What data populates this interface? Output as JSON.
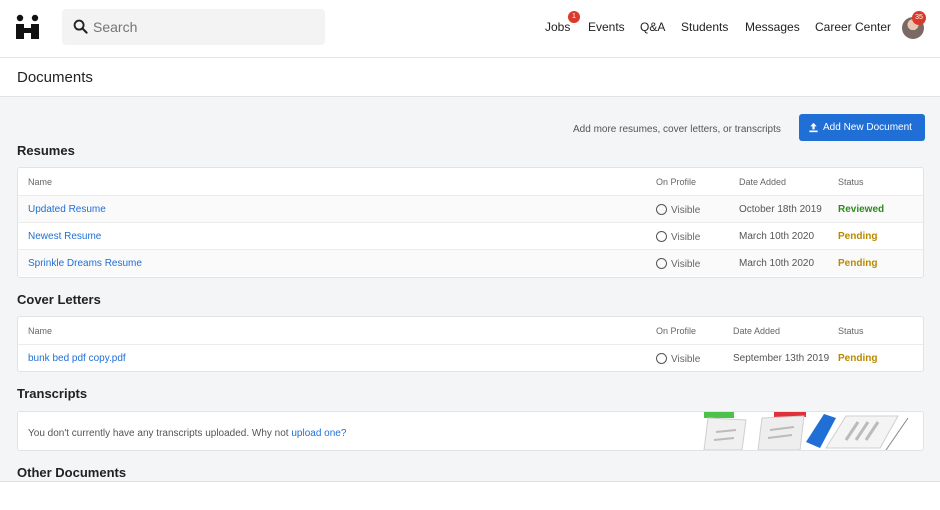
{
  "search": {
    "placeholder": "Search"
  },
  "nav": {
    "items": [
      {
        "label": "Jobs"
      },
      {
        "label": "Events"
      },
      {
        "label": "Q&A"
      },
      {
        "label": "Students"
      },
      {
        "label": "Messages"
      },
      {
        "label": "Career Center"
      }
    ],
    "jobs_badge": "1",
    "avatar_badge": "35"
  },
  "page": {
    "title": "Documents"
  },
  "toolbar": {
    "hint": "Add more resumes, cover letters, or transcripts",
    "add_label": "Add New Document"
  },
  "resumes": {
    "title": "Resumes",
    "headers": {
      "name": "Name",
      "on_profile": "On Profile",
      "date_added": "Date Added",
      "status": "Status"
    },
    "rows": [
      {
        "name": "Updated Resume",
        "visibility": "Visible",
        "date": "October 18th 2019",
        "status": "Reviewed"
      },
      {
        "name": "Newest Resume",
        "visibility": "Visible",
        "date": "March 10th 2020",
        "status": "Pending"
      },
      {
        "name": "Sprinkle Dreams Resume",
        "visibility": "Visible",
        "date": "March 10th 2020",
        "status": "Pending"
      }
    ]
  },
  "cover_letters": {
    "title": "Cover Letters",
    "headers": {
      "name": "Name",
      "on_profile": "On Profile",
      "date_added": "Date Added",
      "status": "Status"
    },
    "rows": [
      {
        "name": "bunk bed pdf copy.pdf",
        "visibility": "Visible",
        "date": "September 13th 2019",
        "status": "Pending"
      }
    ]
  },
  "transcripts": {
    "title": "Transcripts",
    "empty_text": "You don't currently have any transcripts uploaded. Why not ",
    "upload_link": "upload one?"
  },
  "other": {
    "title": "Other Documents"
  },
  "colors": {
    "accent": "#1f6fd6",
    "badge": "#d93a2b",
    "reviewed": "#2f8a1f",
    "pending": "#b78a00"
  }
}
